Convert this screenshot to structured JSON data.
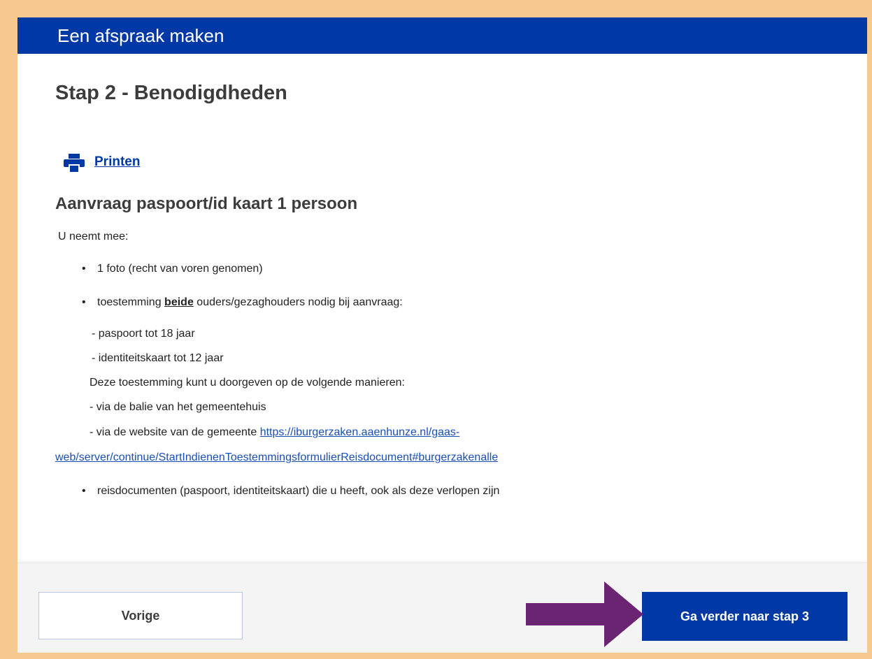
{
  "header": {
    "title": "Een afspraak maken"
  },
  "step": {
    "title": "Stap 2 - Benodigdheden"
  },
  "print": {
    "label": "Printen",
    "icon": "printer-icon"
  },
  "section": {
    "title": "Aanvraag paspoort/id kaart 1 persoon",
    "intro": "U neemt mee:",
    "item1": "1 foto (recht van voren genomen)",
    "item2_before": "toestemming ",
    "item2_bold": "beide",
    "item2_after": " ouders/gezaghouders nodig bij aanvraag:",
    "sub1": "- paspoort tot 18 jaar",
    "sub2": "- identiteitskaart tot 12 jaar",
    "consent_intro": "Deze toestemming kunt u doorgeven op de volgende manieren:",
    "way1": "- via de balie van het gemeentehuis",
    "way2_before": "- via de website van de gemeente ",
    "link_part1": "https://iburgerzaken.aaenhunze.nl/gaas-",
    "link_part2": "web/server/continue/StartIndienenToestemmingsformulierReisdocument#burgerzakenalle",
    "item3": "reisdocumenten (paspoort, identiteitskaart) die u heeft, ook als deze verlopen zijn",
    "bullet_char": "•"
  },
  "footer": {
    "prev_label": "Vorige",
    "next_label": "Ga verder naar stap 3"
  },
  "colors": {
    "brand_blue": "#0039a6",
    "frame_border": "#f5c990",
    "arrow": "#6b2471"
  }
}
